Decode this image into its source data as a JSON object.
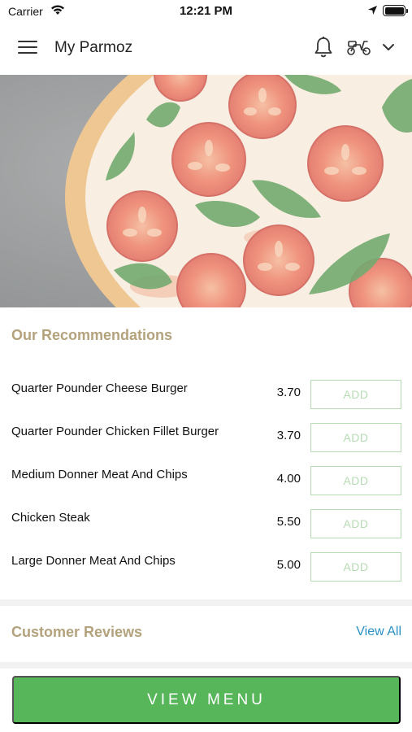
{
  "status_bar": {
    "carrier": "Carrier",
    "time": "12:21 PM"
  },
  "header": {
    "title": "My Parmoz"
  },
  "recommendations": {
    "title": "Our Recommendations",
    "add_label": "ADD",
    "items": [
      {
        "name": "Quarter Pounder Cheese Burger",
        "price": "3.70"
      },
      {
        "name": "Quarter Pounder Chicken Fillet Burger",
        "price": "3.70"
      },
      {
        "name": "Medium Donner Meat And Chips",
        "price": "4.00"
      },
      {
        "name": "Chicken Steak",
        "price": "5.50"
      },
      {
        "name": "Large Donner Meat And Chips",
        "price": "5.00"
      }
    ]
  },
  "reviews": {
    "title": "Customer Reviews",
    "view_all": "View All"
  },
  "footer": {
    "view_menu": "VIEW MENU"
  },
  "colors": {
    "accent_green": "#57b65a",
    "section_title": "#b3a27c",
    "link_blue": "#2a92c4",
    "add_border": "#b6dcb4"
  },
  "icons": [
    "wifi-icon",
    "location-arrow-icon",
    "battery-icon",
    "hamburger-menu-icon",
    "bell-icon",
    "scooter-icon",
    "chevron-down-icon"
  ]
}
